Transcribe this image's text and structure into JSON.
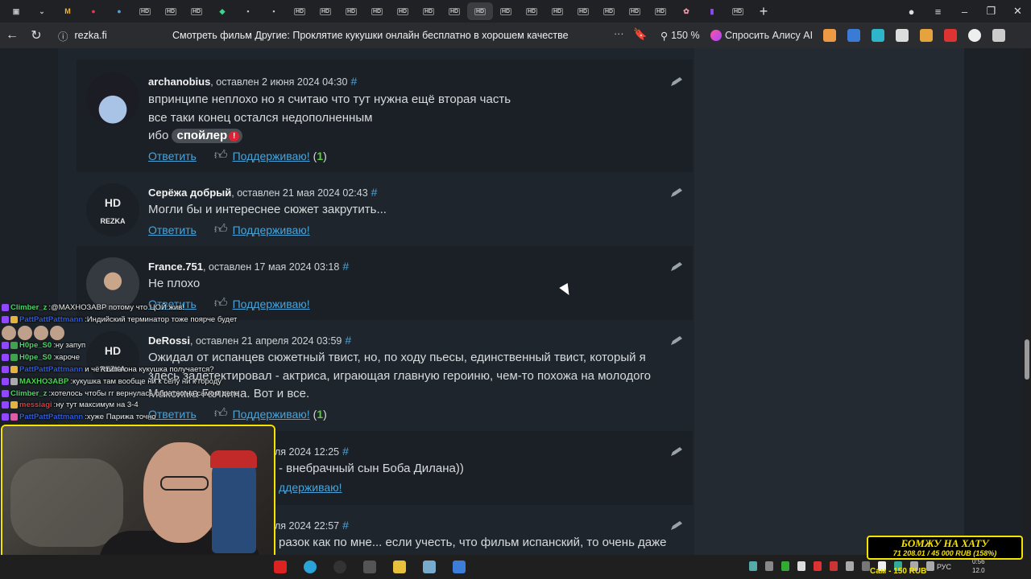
{
  "browser": {
    "url": "rezka.fi",
    "page_title": "Смотреть фильм Другие: Проклятие кукушки онлайн бесплатно в хорошем качестве",
    "zoom": "150 %",
    "ask_alice": "Спросить Алису AI",
    "tab_hd_label": "HD"
  },
  "comments": [
    {
      "author": "archanobius",
      "meta": "оставлен 2 июня 2024 04:30",
      "lines": [
        "впринципе неплохо но я считаю что тут нужна ещё вторая часть",
        "все таки конец остался недополненным",
        "ибо"
      ],
      "spoiler": "спойлер",
      "reply": "Ответить",
      "support": "Поддерживаю!",
      "support_count": "1"
    },
    {
      "author": "Серёжа добрый",
      "meta": "оставлен 21 мая 2024 02:43",
      "lines": [
        "Могли бы и интереснее сюжет закрутить..."
      ],
      "reply": "Ответить",
      "support": "Поддерживаю!",
      "avatar_hd": "HD",
      "avatar_rezka": "REZKA"
    },
    {
      "author": "France.751",
      "meta": "оставлен 17 мая 2024 03:18",
      "lines": [
        "Не плохо"
      ],
      "reply": "Ответить",
      "support": "Поддерживаю!"
    },
    {
      "author": "DeRossi",
      "meta": "оставлен 21 апреля 2024 03:59",
      "lines": [
        "Ожидал от испанцев сюжетный твист, но, по ходу пьесы, единственный твист, который я",
        "здесь задетектировал - актриса, играющая главную героиню, чем-то похожа на молодого",
        "Максима Галкина. Вот и все."
      ],
      "reply": "Ответить",
      "support": "Поддерживаю!",
      "support_count": "1",
      "avatar_hd": "HD",
      "avatar_rezka": "REZKA"
    },
    {
      "meta": "ля 2024 12:25",
      "lines": [
        "- внебрачный сын Боба Дилана))"
      ],
      "support": "ддерживаю!"
    },
    {
      "meta": "ля 2024 22:57",
      "lines": [
        "разок как по мне... если учесть, что фильм испанский, то очень даже"
      ]
    }
  ],
  "chat": [
    {
      "nick": "Climber_z",
      "color": "#4fd36b",
      "text": "@МАХНОЗАВР потому что ЦОЙ жив!"
    },
    {
      "nick": "PattPattPattmann",
      "color": "#2f5bd8",
      "text": "Индийский терминатор тоже поярче будет"
    },
    {
      "nick": "H0pe_S0",
      "color": "#4fd36b",
      "text": "ну запуп"
    },
    {
      "nick": "H0pe_S0",
      "color": "#4fd36b",
      "text": "кароче"
    },
    {
      "nick": "PattPattPattmann",
      "color": "#2f5bd8",
      "text": "и чё? типа она кукушка получается?"
    },
    {
      "nick": "МАХНОЗАВР",
      "color": "#46d84f",
      "text": "кукушка там вообще ни к селу ни к городу"
    },
    {
      "nick": "Climber_z",
      "color": "#4fd36b",
      "text": "хотелось чтобы гг вернулась обратно на самом деле"
    },
    {
      "nick": "messiagi",
      "color": "#e03a3a",
      "text": "ну тут максимум на 3-4"
    },
    {
      "nick": "PattPattPattmann",
      "color": "#2f5bd8",
      "text": "хуже Парижа точно"
    }
  ],
  "donation": {
    "title": "БОМЖУ НА ХАТУ",
    "progress_text": "71 208.01 / 45 000 RUB (158%)",
    "progress_fraction": 1.58,
    "below": "Сам - 150 RUB"
  },
  "taskbar": {
    "lang": "РУС",
    "time": "0:56",
    "date": "12.0"
  },
  "colors": {
    "accent_link": "#4aa3d8",
    "support_count": "#5dcc3b",
    "highlight_frame": "#f5e400"
  }
}
